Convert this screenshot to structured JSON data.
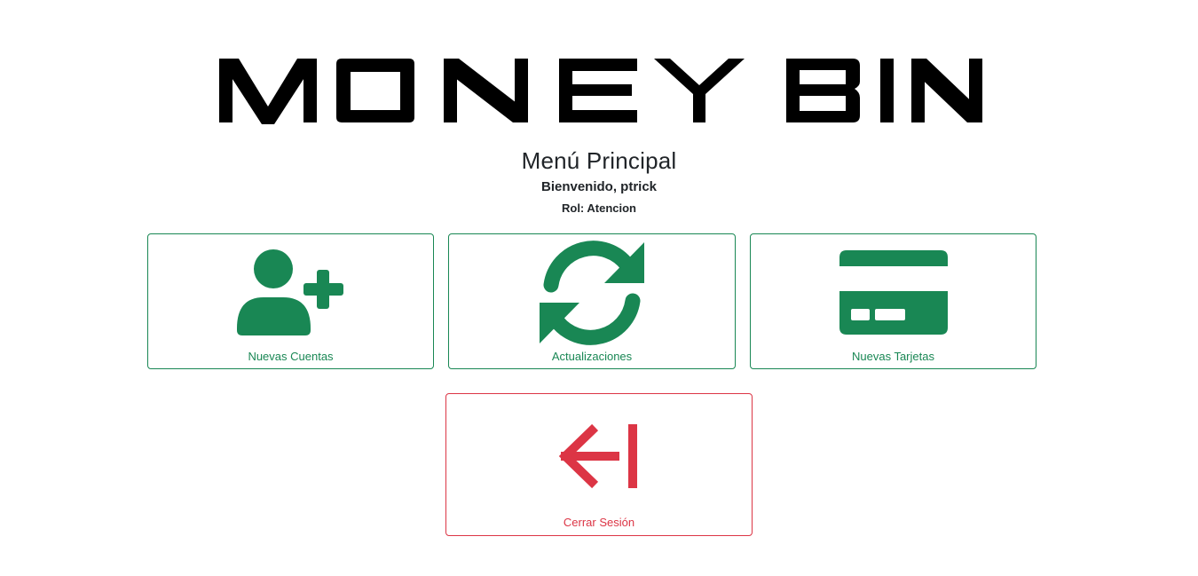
{
  "logo": {
    "text": "MONEY BIN"
  },
  "header": {
    "title": "Menú Principal",
    "welcome": "Bienvenido, ptrick",
    "role": "Rol: Atencion"
  },
  "menu": {
    "items": [
      {
        "label": "Nuevas Cuentas",
        "icon": "person-plus-icon",
        "color": "#198754"
      },
      {
        "label": "Actualizaciones",
        "icon": "refresh-icon",
        "color": "#198754"
      },
      {
        "label": "Nuevas Tarjetas",
        "icon": "credit-card-icon",
        "color": "#198754"
      }
    ],
    "logout": {
      "label": "Cerrar Sesión",
      "icon": "logout-arrow-icon",
      "color": "#dc3545"
    }
  }
}
